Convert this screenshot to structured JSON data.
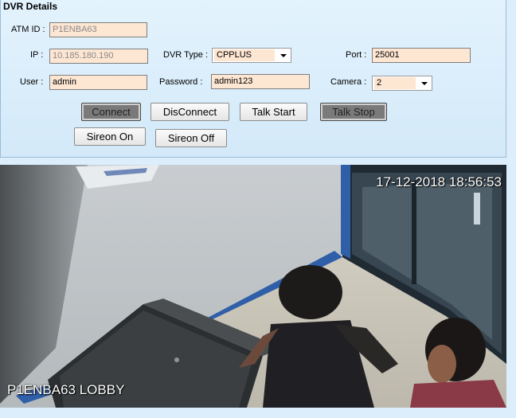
{
  "panel": {
    "title": "DVR Details"
  },
  "form": {
    "atm_id": {
      "label": "ATM ID :",
      "value": "P1ENBA63"
    },
    "ip": {
      "label": "IP :",
      "value": "10.185.180.190"
    },
    "dvr_type": {
      "label": "DVR Type :",
      "value": "CPPLUS"
    },
    "port": {
      "label": "Port :",
      "value": "25001"
    },
    "user": {
      "label": "User :",
      "value": "admin"
    },
    "password": {
      "label": "Password :",
      "value": "admin123"
    },
    "camera": {
      "label": "Camera :",
      "value": "2"
    }
  },
  "buttons": {
    "connect": "Connect",
    "disconnect": "DisConnect",
    "talk_start": "Talk Start",
    "talk_stop": "Talk Stop",
    "sireon_on": "Sireon On",
    "sireon_off": "Sireon Off"
  },
  "camera_feed": {
    "timestamp": "17-12-2018 18:56:53",
    "overlay_label": "P1ENBA63 LOBBY"
  }
}
